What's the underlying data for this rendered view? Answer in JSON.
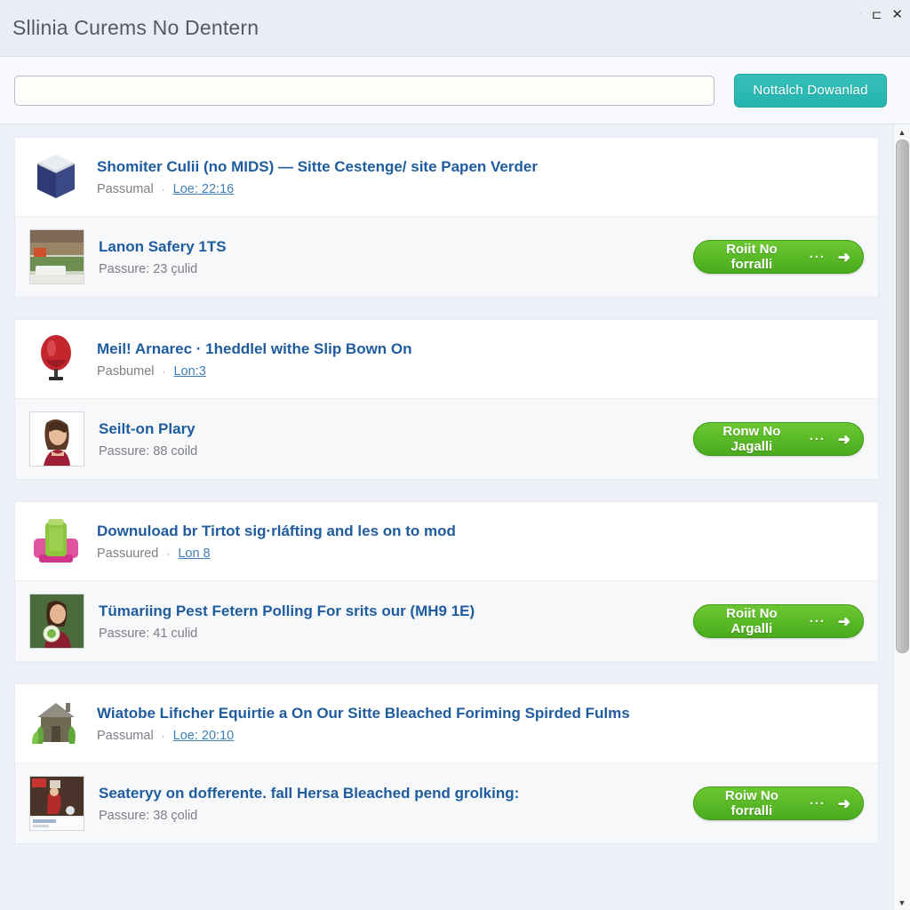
{
  "window": {
    "title": "Sllinia Curems No Dentern",
    "controls": {
      "minimize": "·",
      "maximize": "⊏",
      "close": "✕"
    }
  },
  "search": {
    "value": "",
    "placeholder": "",
    "button_label": "Nottalch Dowanlad"
  },
  "scrollbar": {
    "up_arrow": "▲",
    "down_arrow": "▼",
    "thumb_position_percent": 0,
    "thumb_size_percent": 68
  },
  "groups": [
    {
      "rows": [
        {
          "icon": "blue-box-icon",
          "title": "Shomiter Culii (no MIDS) — Sitte Cestenge/ site Papen Verder",
          "meta_label": "Passumal",
          "meta_separator": "·",
          "meta_link": "Loe: 22:16",
          "has_button": false,
          "button_label": "",
          "button_ellipsis": "",
          "button_arrow": ""
        },
        {
          "icon": "neighborhood-photo-icon",
          "title": "Lanon Safery 1TS",
          "meta_label": "Passure: 23 çulid",
          "meta_separator": "",
          "meta_link": "",
          "has_button": true,
          "button_label": "Roiit No forralli",
          "button_ellipsis": "···",
          "button_arrow": "➜"
        }
      ]
    },
    {
      "rows": [
        {
          "icon": "red-balloon-icon",
          "title": "Meil! Arnarec · 1heddlel withe Slip Bown On",
          "meta_label": "Pasbumel",
          "meta_separator": "·",
          "meta_link": "Lon:3",
          "has_button": false,
          "button_label": "",
          "button_ellipsis": "",
          "button_arrow": ""
        },
        {
          "icon": "woman-portrait-icon",
          "title": "Seilt-on Plary",
          "meta_label": "Passure: 88 coild",
          "meta_separator": "",
          "meta_link": "",
          "has_button": true,
          "button_label": "Ronw No Jagalli",
          "button_ellipsis": "···",
          "button_arrow": "➜"
        }
      ]
    },
    {
      "rows": [
        {
          "icon": "green-pink-machine-icon",
          "title": "Downuload br Tirtot sig·rláfting and les on to mod",
          "meta_label": "Passuured",
          "meta_separator": "·",
          "meta_link": "Lon 8",
          "has_button": false,
          "button_label": "",
          "button_ellipsis": "",
          "button_arrow": ""
        },
        {
          "icon": "woman-holding-plate-icon",
          "title": "Tümariing Pest Fetern Polling For srits our (MH9 1E)",
          "meta_label": "Passure: 41 culid",
          "meta_separator": "",
          "meta_link": "",
          "has_button": true,
          "button_label": "Roiit No Argalli",
          "button_ellipsis": "···",
          "button_arrow": "➜"
        }
      ]
    },
    {
      "rows": [
        {
          "icon": "house-with-plants-icon",
          "title": "Wiatobe Lifıcher Equirtie a On Our Sitte Bleached Foriming Spirded Fulms",
          "meta_label": "Passumal",
          "meta_separator": "·",
          "meta_link": "Loe: 20:10",
          "has_button": false,
          "button_label": "",
          "button_ellipsis": "",
          "button_arrow": ""
        },
        {
          "icon": "red-scene-photo-icon",
          "title": "Seateryy on dofferente. fall Hersa Bleached pend grolking:",
          "meta_label": "Passure: 38 çolid",
          "meta_separator": "",
          "meta_link": "",
          "has_button": true,
          "button_label": "Roiw No forralli",
          "button_ellipsis": "···",
          "button_arrow": "➜"
        }
      ]
    }
  ],
  "colors": {
    "page_bg": "#edf1f7",
    "card_bg": "#ffffff",
    "title_link": "#1f5c9e",
    "teal_button": "#2bb8b3",
    "green_button": "#5cbf28",
    "meta_text": "#7c7f85"
  }
}
